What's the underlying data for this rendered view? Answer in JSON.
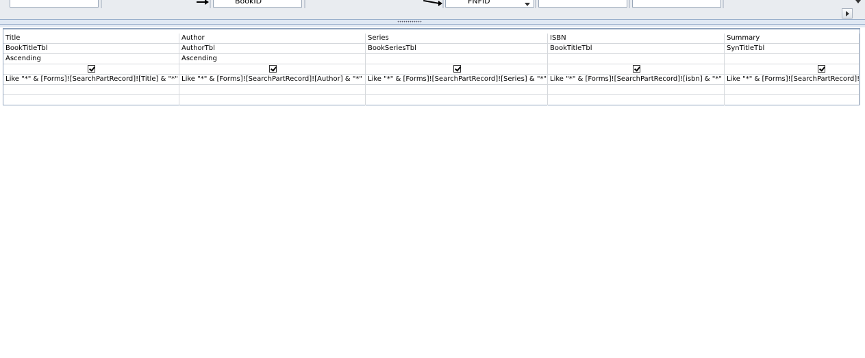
{
  "design_view": {
    "tables": [
      {
        "field": ""
      },
      {
        "field": ""
      },
      {
        "field": "BookID"
      },
      {
        "field": ""
      },
      {
        "field": "FNFID"
      },
      {
        "field": ""
      },
      {
        "field": ""
      },
      {
        "field": ""
      }
    ]
  },
  "grid": {
    "columns": [
      {
        "field": "Title",
        "table": "BookTitleTbl",
        "sort": "Ascending",
        "show": true,
        "criteria": "Like \"*\" & [Forms]![SearchPartRecord]![Title] & \"*\""
      },
      {
        "field": "Author",
        "table": "AuthorTbl",
        "sort": "Ascending",
        "show": true,
        "criteria": "Like \"*\" & [Forms]![SearchPartRecord]![Author] & \"*\""
      },
      {
        "field": "Series",
        "table": "BookSeriesTbl",
        "sort": "",
        "show": true,
        "criteria": "Like \"*\" & [Forms]![SearchPartRecord]![Series] & \"*\""
      },
      {
        "field": "ISBN",
        "table": "BookTitleTbl",
        "sort": "",
        "show": true,
        "criteria": "Like \"*\" & [Forms]![SearchPartRecord]![isbn] & \"*\""
      },
      {
        "field": "Summary",
        "table": "SynTitleTbl",
        "sort": "",
        "show": true,
        "criteria": "Like \"*\" & [Forms]![SearchPartRecord]!["
      }
    ]
  }
}
